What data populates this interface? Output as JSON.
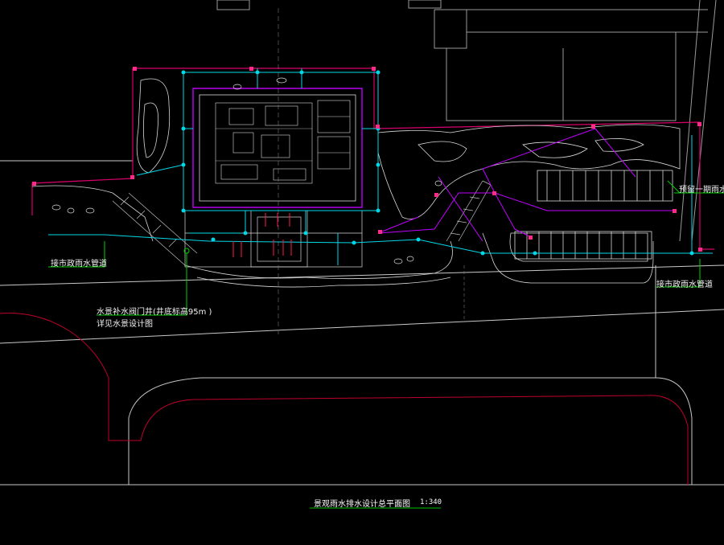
{
  "drawing": {
    "background": "#000000",
    "colors": {
      "boundary_magenta": "#d9006c",
      "building_magenta": "#c000ff",
      "pipe_cyan": "#00d8e8",
      "leader_green": "#00d000",
      "road_red": "#c0002a",
      "linework_white": "#d8d8d8",
      "hatch_gray": "#7a7a7a",
      "title_underline": "#00c000"
    }
  },
  "annotations": {
    "municipal_rain_left": "接市政雨水管道",
    "municipal_rain_right": "接市政雨水管道",
    "reserved_rain_pipe": "预留一期雨水管",
    "valve_well_line1": "水景补水阀门井(井底标高95m    )",
    "valve_well_line2": "详见水景设计图"
  },
  "title_block": {
    "title": "景观雨水排水设计总平面图",
    "scale": "1:340"
  }
}
